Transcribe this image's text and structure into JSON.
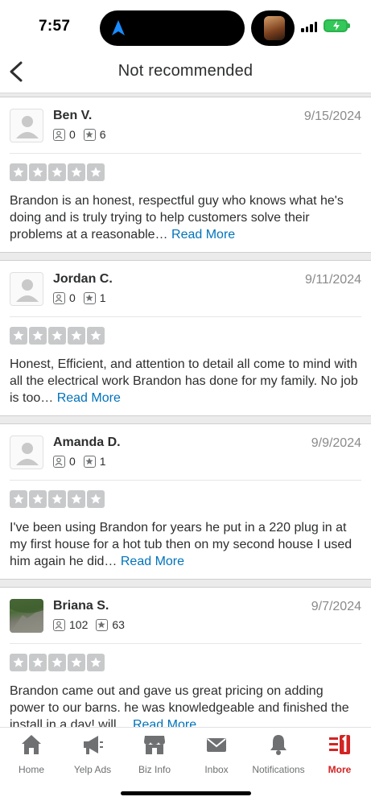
{
  "status_bar": {
    "time": "7:57"
  },
  "header": {
    "title": "Not recommended"
  },
  "reviews": [
    {
      "name": "Ben V.",
      "date": "9/15/2024",
      "friends": "0",
      "reviews": "6",
      "rating": 5,
      "avatar": "default-avatar-icon",
      "text": "Brandon is an honest, respectful guy who knows what he's doing and is truly trying to help customers solve their problems at a reasonable…",
      "read_more": "Read More"
    },
    {
      "name": "Jordan C.",
      "date": "9/11/2024",
      "friends": "0",
      "reviews": "1",
      "rating": 5,
      "avatar": "default-avatar-icon",
      "text": "Honest, Efficient, and attention to detail all come to mind with all the electrical work Brandon has done for my family. No job is too…",
      "read_more": "Read More"
    },
    {
      "name": "Amanda D.",
      "date": "9/9/2024",
      "friends": "0",
      "reviews": "1",
      "rating": 5,
      "avatar": "default-avatar-icon",
      "text": "I've been using Brandon for years he put in a 220 plug in at my first house for a hot tub then on my second house I used him again he did…",
      "read_more": "Read More"
    },
    {
      "name": "Briana S.",
      "date": "9/7/2024",
      "friends": "102",
      "reviews": "63",
      "rating": 5,
      "avatar": "user-photo",
      "text": "Brandon came out and gave us great pricing on adding power to our barns. he was knowledgeable and finished the install in a day! will…",
      "read_more": "Read More"
    }
  ],
  "tabbar": {
    "items": [
      {
        "label": "Home",
        "icon": "home-icon"
      },
      {
        "label": "Yelp Ads",
        "icon": "megaphone-icon"
      },
      {
        "label": "Biz Info",
        "icon": "storefront-icon"
      },
      {
        "label": "Inbox",
        "icon": "envelope-icon"
      },
      {
        "label": "Notifications",
        "icon": "bell-icon"
      },
      {
        "label": "More",
        "icon": "more-icon",
        "active": true
      }
    ]
  },
  "colors": {
    "accent": "#d32323",
    "link": "#0073bb",
    "star_unrated": "#c8c9ca",
    "battery": "#34c759"
  }
}
